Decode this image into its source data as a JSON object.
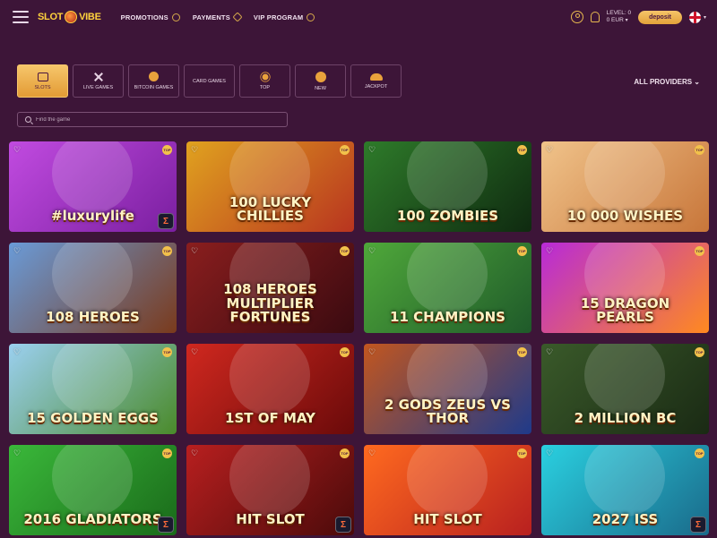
{
  "header": {
    "logo": {
      "part1": "SLOT",
      "part2": "VIBE"
    },
    "nav": [
      {
        "label": "PROMOTIONS",
        "icon": "gift-icon"
      },
      {
        "label": "PAYMENTS",
        "icon": "tag-icon"
      },
      {
        "label": "VIP PROGRAM",
        "icon": "crown-icon"
      }
    ],
    "level": "LEVEL: 0",
    "balance": "0 EUR",
    "deposit_label": "deposit"
  },
  "categories": [
    {
      "label": "SLOTS",
      "icon": "slots-icon",
      "active": true
    },
    {
      "label": "LIVE GAMES",
      "icon": "cards-cross-icon",
      "active": false
    },
    {
      "label": "BITCOIN GAMES",
      "icon": "bitcoin-icon",
      "active": false
    },
    {
      "label": "CARD GAMES",
      "icon": "card-icon",
      "active": false
    },
    {
      "label": "TOP",
      "icon": "sun-icon",
      "active": false
    },
    {
      "label": "NEW",
      "icon": "new-icon",
      "active": false
    },
    {
      "label": "JACKPOT",
      "icon": "hat-icon",
      "active": false
    }
  ],
  "providers_label": "ALL PROVIDERS",
  "search": {
    "placeholder": "Find the game"
  },
  "top_badge": "TOP",
  "games": [
    {
      "title": "#luxurylife",
      "bg": [
        "#c14be0",
        "#7a1fa0"
      ],
      "provider": true
    },
    {
      "title": "100 LUCKY CHILLIES",
      "bg": [
        "#e0a21f",
        "#b8341f"
      ],
      "provider": false
    },
    {
      "title": "100 ZOMBIES",
      "bg": [
        "#2e7b2a",
        "#0f2a10"
      ],
      "provider": false
    },
    {
      "title": "10 000 WISHES",
      "bg": [
        "#f0c38a",
        "#c8763a"
      ],
      "provider": false
    },
    {
      "title": "108 HEROES",
      "bg": [
        "#6a9bd8",
        "#7a3a1c"
      ],
      "provider": false
    },
    {
      "title": "108 HEROES MULTIPLIER FORTUNES",
      "bg": [
        "#8a1e1e",
        "#3a0a10"
      ],
      "provider": false
    },
    {
      "title": "11 CHAMPIONS",
      "bg": [
        "#4fa83a",
        "#1f5a2a"
      ],
      "provider": false
    },
    {
      "title": "15 DRAGON PEARLS",
      "bg": [
        "#b82ad8",
        "#ff8a1f"
      ],
      "provider": false
    },
    {
      "title": "15 GOLDEN EGGS",
      "bg": [
        "#9bd0f0",
        "#4a8a2a"
      ],
      "provider": false
    },
    {
      "title": "1ST OF MAY",
      "bg": [
        "#d0281f",
        "#6a0a0a"
      ],
      "provider": false
    },
    {
      "title": "2 GODS ZEUS VS THOR",
      "bg": [
        "#c2561f",
        "#1f3a8a"
      ],
      "provider": false
    },
    {
      "title": "2 MILLION BC",
      "bg": [
        "#3a5a2a",
        "#1a2a14"
      ],
      "provider": false
    },
    {
      "title": "2016 GLADIATORS",
      "bg": [
        "#3ab83a",
        "#1a6a1a"
      ],
      "provider": true
    },
    {
      "title": "HIT SLOT",
      "bg": [
        "#b81f1f",
        "#4a0a0a"
      ],
      "provider": true
    },
    {
      "title": "HIT SLOT",
      "bg": [
        "#ff6a1f",
        "#b8201f"
      ],
      "provider": false
    },
    {
      "title": "2027 ISS",
      "bg": [
        "#2ad0e0",
        "#1a6a8a"
      ],
      "provider": true
    }
  ]
}
